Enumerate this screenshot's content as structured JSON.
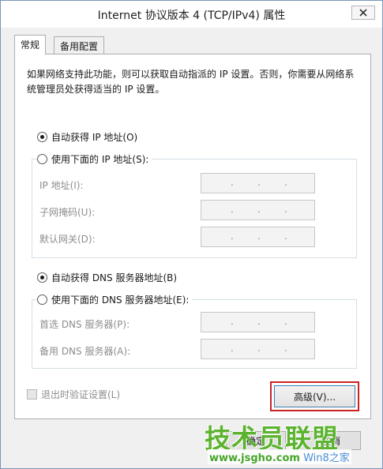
{
  "window": {
    "title": "Internet 协议版本 4 (TCP/IPv4) 属性"
  },
  "tabs": [
    {
      "label": "常规",
      "active": true
    },
    {
      "label": "备用配置",
      "active": false
    }
  ],
  "description": "如果网络支持此功能，则可以获取自动指派的 IP 设置。否则，你需要从网络系统管理员处获得适当的 IP 设置。",
  "ip": {
    "auto_label": "自动获得 IP 地址(O)",
    "auto_selected": true,
    "manual_label": "使用下面的 IP 地址(S):",
    "manual_selected": false,
    "fields": [
      {
        "label": "IP 地址(I):",
        "value": ". . ."
      },
      {
        "label": "子网掩码(U):",
        "value": ". . ."
      },
      {
        "label": "默认网关(D):",
        "value": ". . ."
      }
    ]
  },
  "dns": {
    "auto_label": "自动获得 DNS 服务器地址(B)",
    "auto_selected": true,
    "manual_label": "使用下面的 DNS 服务器地址(E):",
    "manual_selected": false,
    "fields": [
      {
        "label": "首选 DNS 服务器(P):",
        "value": ". . ."
      },
      {
        "label": "备用 DNS 服务器(A):",
        "value": ". . ."
      }
    ]
  },
  "validate_label": "退出时验证设置(L)",
  "validate_checked": false,
  "advanced_button": "高级(V)...",
  "footer": {
    "ok_label": "确定",
    "cancel_label": "取消"
  },
  "watermark": {
    "main": "技术员联盟",
    "sub_prefix": "Win8之家",
    "sub_site": "www.jsgho.com"
  },
  "colors": {
    "highlight": "#cc2222",
    "watermark_green": "#5bb32f",
    "watermark_blue": "#4a8fd8"
  }
}
